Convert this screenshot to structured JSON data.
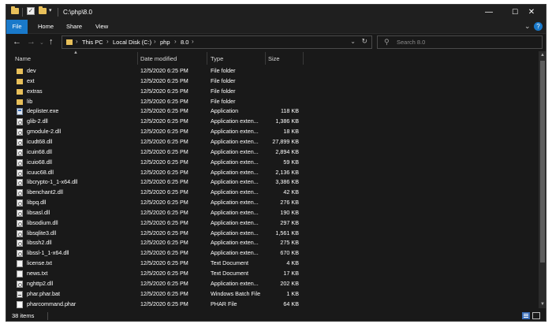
{
  "window": {
    "title": "C:\\php\\8.0",
    "buttons": {
      "minimize": "—",
      "maximize": "☐",
      "close": "✕"
    }
  },
  "ribbon": {
    "tabs": [
      "File",
      "Home",
      "Share",
      "View"
    ],
    "collapse_icon": "chevron-down-icon",
    "help_label": "?"
  },
  "nav": {
    "breadcrumbs": [
      "This PC",
      "Local Disk (C:)",
      "php",
      "8.0"
    ],
    "search_placeholder": "Search 8.0"
  },
  "columns": {
    "name": "Name",
    "date": "Date modified",
    "type": "Type",
    "size": "Size"
  },
  "files": [
    {
      "name": "dev",
      "date": "12/5/2020 6:25 PM",
      "type": "File folder",
      "size": "",
      "icon": "folder"
    },
    {
      "name": "ext",
      "date": "12/5/2020 6:25 PM",
      "type": "File folder",
      "size": "",
      "icon": "folder"
    },
    {
      "name": "extras",
      "date": "12/5/2020 6:25 PM",
      "type": "File folder",
      "size": "",
      "icon": "folder"
    },
    {
      "name": "lib",
      "date": "12/5/2020 6:25 PM",
      "type": "File folder",
      "size": "",
      "icon": "folder"
    },
    {
      "name": "deplister.exe",
      "date": "12/5/2020 6:25 PM",
      "type": "Application",
      "size": "118 KB",
      "icon": "app"
    },
    {
      "name": "glib-2.dll",
      "date": "12/5/2020 6:25 PM",
      "type": "Application exten...",
      "size": "1,386 KB",
      "icon": "dll"
    },
    {
      "name": "gmodule-2.dll",
      "date": "12/5/2020 6:25 PM",
      "type": "Application exten...",
      "size": "18 KB",
      "icon": "dll"
    },
    {
      "name": "icudt68.dll",
      "date": "12/5/2020 6:25 PM",
      "type": "Application exten...",
      "size": "27,899 KB",
      "icon": "dll"
    },
    {
      "name": "icuin68.dll",
      "date": "12/5/2020 6:25 PM",
      "type": "Application exten...",
      "size": "2,894 KB",
      "icon": "dll"
    },
    {
      "name": "icuio68.dll",
      "date": "12/5/2020 6:25 PM",
      "type": "Application exten...",
      "size": "59 KB",
      "icon": "dll"
    },
    {
      "name": "icuuc68.dll",
      "date": "12/5/2020 6:25 PM",
      "type": "Application exten...",
      "size": "2,136 KB",
      "icon": "dll"
    },
    {
      "name": "libcrypto-1_1-x64.dll",
      "date": "12/5/2020 6:25 PM",
      "type": "Application exten...",
      "size": "3,386 KB",
      "icon": "dll"
    },
    {
      "name": "libenchant2.dll",
      "date": "12/5/2020 6:25 PM",
      "type": "Application exten...",
      "size": "42 KB",
      "icon": "dll"
    },
    {
      "name": "libpq.dll",
      "date": "12/5/2020 6:25 PM",
      "type": "Application exten...",
      "size": "276 KB",
      "icon": "dll"
    },
    {
      "name": "libsasl.dll",
      "date": "12/5/2020 6:25 PM",
      "type": "Application exten...",
      "size": "190 KB",
      "icon": "dll"
    },
    {
      "name": "libsodium.dll",
      "date": "12/5/2020 6:25 PM",
      "type": "Application exten...",
      "size": "297 KB",
      "icon": "dll"
    },
    {
      "name": "libsqlite3.dll",
      "date": "12/5/2020 6:25 PM",
      "type": "Application exten...",
      "size": "1,561 KB",
      "icon": "dll"
    },
    {
      "name": "libssh2.dll",
      "date": "12/5/2020 6:25 PM",
      "type": "Application exten...",
      "size": "275 KB",
      "icon": "dll"
    },
    {
      "name": "libssl-1_1-x64.dll",
      "date": "12/5/2020 6:25 PM",
      "type": "Application exten...",
      "size": "670 KB",
      "icon": "dll"
    },
    {
      "name": "license.txt",
      "date": "12/5/2020 6:25 PM",
      "type": "Text Document",
      "size": "4 KB",
      "icon": "file"
    },
    {
      "name": "news.txt",
      "date": "12/5/2020 6:25 PM",
      "type": "Text Document",
      "size": "17 KB",
      "icon": "file"
    },
    {
      "name": "nghttp2.dll",
      "date": "12/5/2020 6:25 PM",
      "type": "Application exten...",
      "size": "202 KB",
      "icon": "dll"
    },
    {
      "name": "phar.phar.bat",
      "date": "12/5/2020 6:25 PM",
      "type": "Windows Batch File",
      "size": "1 KB",
      "icon": "bat"
    },
    {
      "name": "pharcommand.phar",
      "date": "12/5/2020 6:25 PM",
      "type": "PHAR File",
      "size": "64 KB",
      "icon": "phar"
    }
  ],
  "status": {
    "items": "38 items"
  },
  "colors": {
    "background": "#191919",
    "accent": "#1979ca",
    "folder": "#e8c05a"
  }
}
